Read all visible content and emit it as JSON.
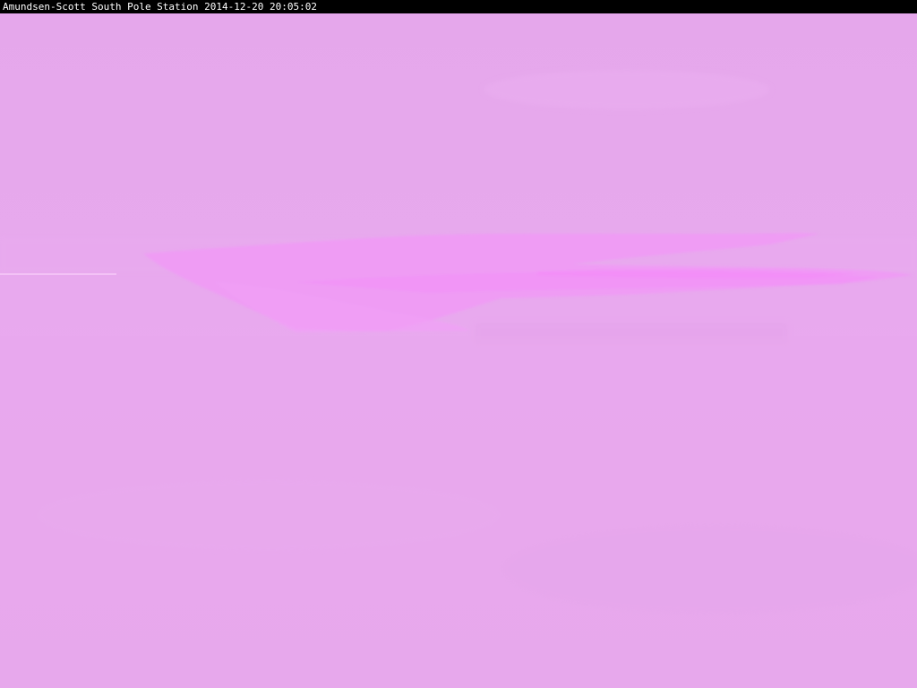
{
  "caption": {
    "station_name": "Amundsen-Scott South Pole Station",
    "timestamp": "2014-12-20 20:05:02"
  },
  "palette": {
    "sky": "#e6a8ec",
    "ground": "#e7a8ec",
    "horizon_streak": "#f09af6",
    "horizon_highlight": "#f2a0f8",
    "caption_bar": "#000000",
    "caption_text": "#ffffff"
  }
}
